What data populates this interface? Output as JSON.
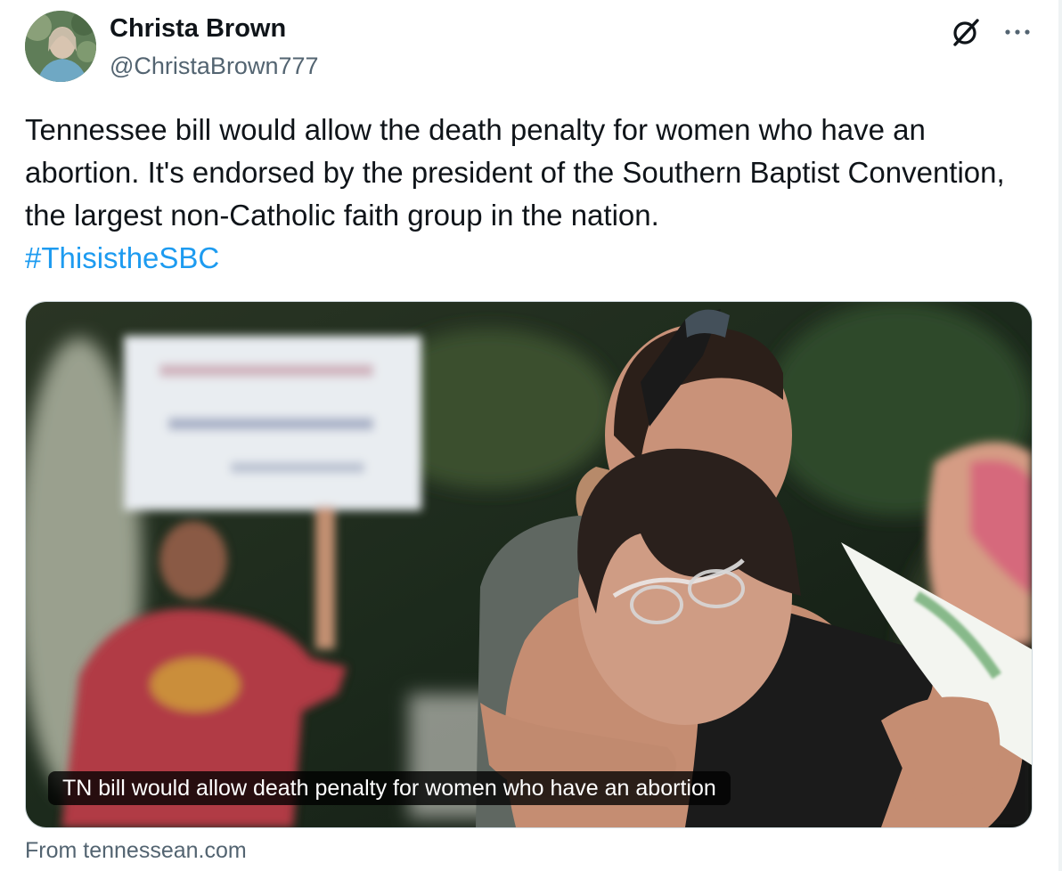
{
  "author": {
    "display_name": "Christa Brown",
    "handle": "@ChristaBrown777"
  },
  "header_icons": [
    "grok-icon",
    "more-icon"
  ],
  "tweet": {
    "text_plain": "Tennessee bill would allow the death penalty for women who have an abortion. It's endorsed by the president of the Southern Baptist Convention, the largest non-Catholic faith group in the nation.",
    "hashtag": "#ThisistheSBC"
  },
  "link_card": {
    "caption": "TN bill would allow death penalty for women who have an abortion",
    "source": "From tennessean.com"
  },
  "colors": {
    "text": "#0f1419",
    "secondary": "#536471",
    "link": "#1d9bf0"
  }
}
